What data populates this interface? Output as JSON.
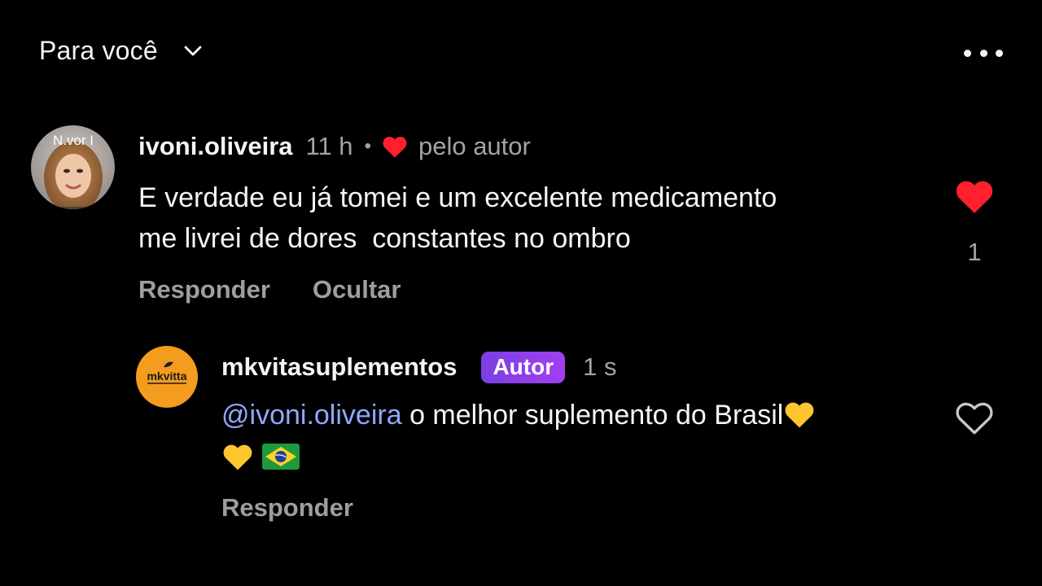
{
  "header": {
    "filter_label": "Para você"
  },
  "comments": [
    {
      "avatar_label": "N.vor I",
      "username": "ivoni.oliveira",
      "time": "11 h",
      "liked_by_author_label": "pelo autor",
      "text": "E verdade eu já tomei e um excelente medicamento\nme livrei de dores  constantes no ombro",
      "actions": {
        "reply": "Responder",
        "hide": "Ocultar"
      },
      "liked": true,
      "like_count": "1"
    },
    {
      "avatar_label": "mkvitta",
      "username": "mkvitasuplementos",
      "badge": "Autor",
      "time": "1 s",
      "mention": "@ivoni.oliveira",
      "text": "o melhor suplemento do Brasil",
      "emojis": [
        "yellow-heart",
        "yellow-heart",
        "brazil-flag"
      ],
      "actions": {
        "reply": "Responder"
      },
      "liked": false
    }
  ],
  "colors": {
    "background": "#000000",
    "heart_red": "#FF1F2D",
    "mention_blue": "#8fa8ff",
    "badge_purple": "#8a3ff0",
    "brand_orange": "#F39C1E",
    "muted_text": "#a3a3a3"
  }
}
